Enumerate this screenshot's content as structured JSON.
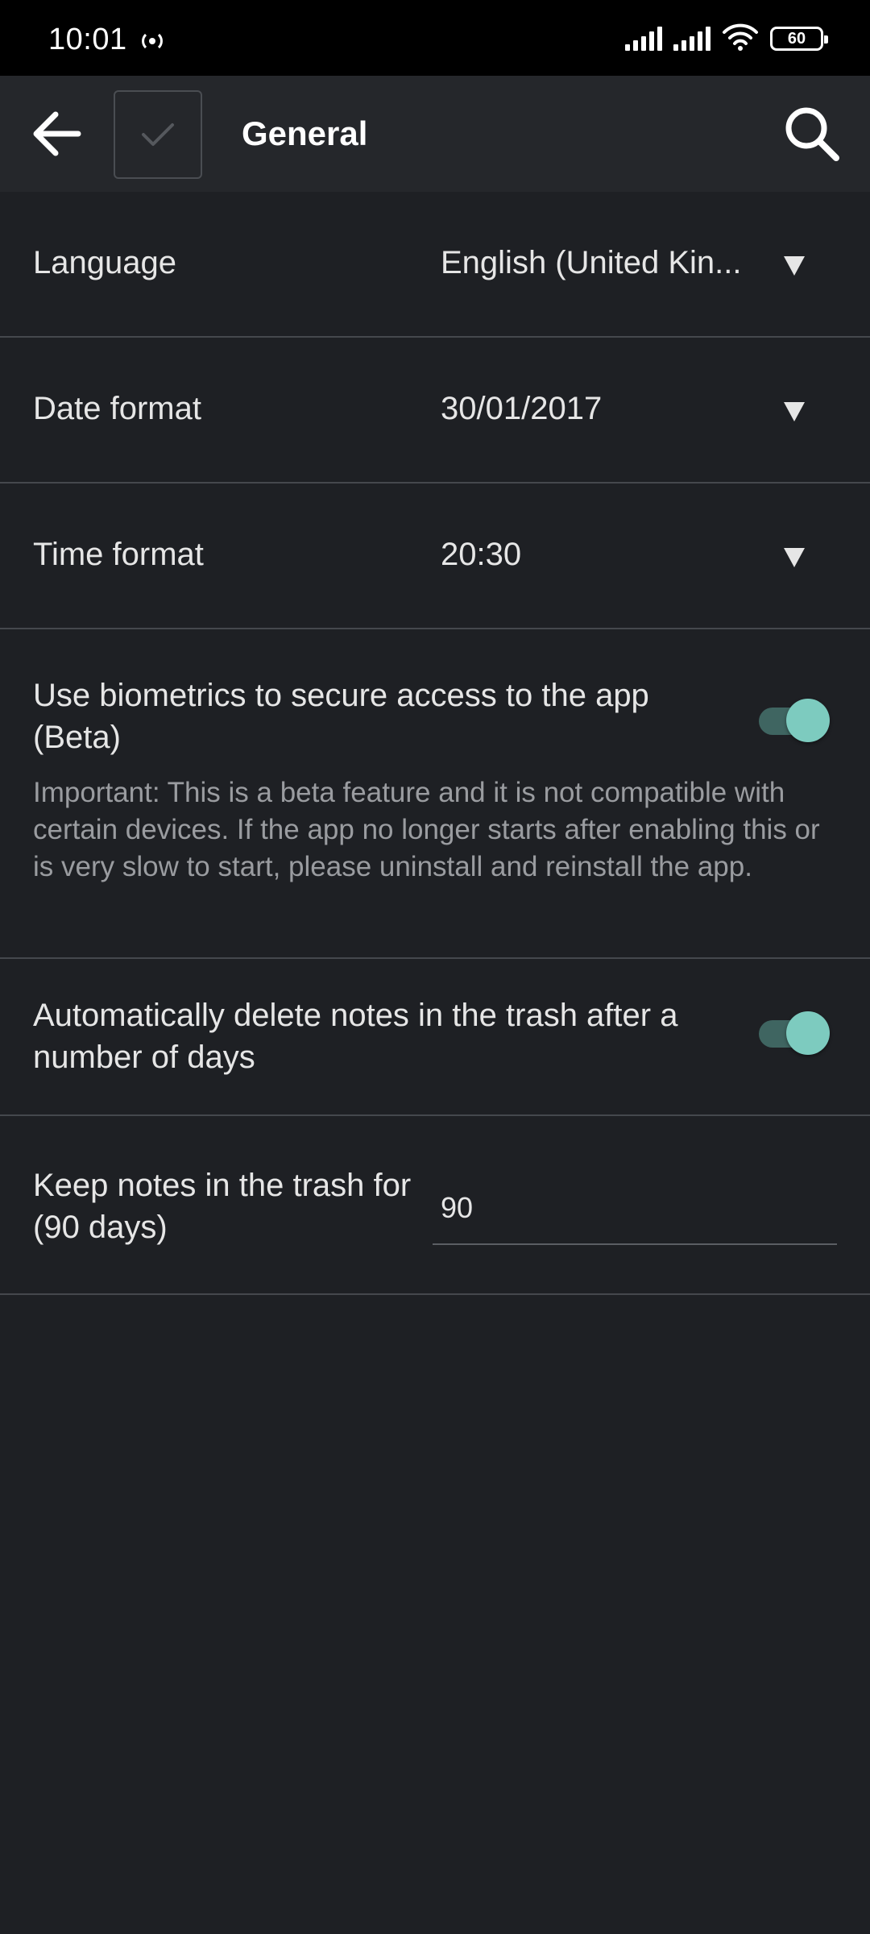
{
  "status_bar": {
    "time": "10:01",
    "battery": "60"
  },
  "app_bar": {
    "title": "General"
  },
  "settings": {
    "language": {
      "label": "Language",
      "value": "English (United Kin..."
    },
    "date_format": {
      "label": "Date format",
      "value": "30/01/2017"
    },
    "time_format": {
      "label": "Time format",
      "value": "20:30"
    },
    "biometrics": {
      "label": "Use biometrics to secure access to the app (Beta)",
      "description": "Important: This is a beta feature and it is not compatible with certain devices. If the app no longer starts after enabling this or is very slow to start, please uninstall and reinstall the app.",
      "enabled": true
    },
    "auto_delete": {
      "label": "Automatically delete notes in the trash after a number of days",
      "enabled": true
    },
    "keep_days": {
      "label": "Keep notes in the trash for (90 days)",
      "value": "90"
    }
  },
  "colors": {
    "background": "#1e2024",
    "app_bar": "#25272b",
    "accent": "#7dcbbf",
    "divider": "#45484d"
  },
  "icons": {
    "back": "arrow-left-icon",
    "select_all": "check-icon",
    "search": "search-icon",
    "dropdown": "triangle-down-icon"
  }
}
